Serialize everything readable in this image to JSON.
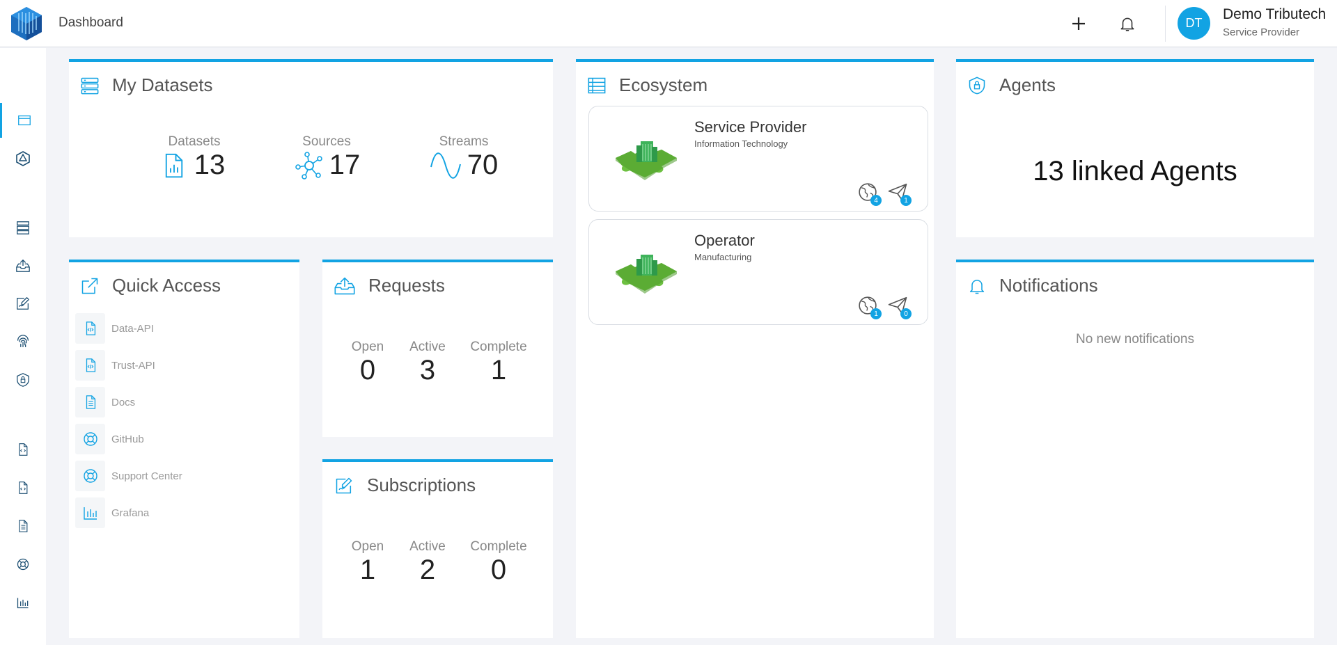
{
  "header": {
    "page_title": "Dashboard",
    "user_initials": "DT",
    "user_name": "Demo Tributech",
    "user_role": "Service Provider"
  },
  "colors": {
    "accent": "#12a3e3",
    "background": "#f3f4f8",
    "puzzle_green": "#6dc041"
  },
  "sidebar": {
    "items": [
      {
        "icon": "window-icon"
      },
      {
        "icon": "ecosystem-icon"
      },
      {
        "icon": "datasets-icon"
      },
      {
        "icon": "requests-icon"
      },
      {
        "icon": "subscriptions-icon"
      },
      {
        "icon": "fingerprint-icon"
      },
      {
        "icon": "agents-icon"
      },
      {
        "icon": "code-file-icon"
      },
      {
        "icon": "code-file-icon"
      },
      {
        "icon": "document-icon"
      },
      {
        "icon": "support-icon"
      },
      {
        "icon": "chart-icon"
      }
    ]
  },
  "datasets": {
    "title": "My Datasets",
    "stats": [
      {
        "label": "Datasets",
        "value": "13",
        "icon": "dataset-file-icon"
      },
      {
        "label": "Sources",
        "value": "17",
        "icon": "network-icon"
      },
      {
        "label": "Streams",
        "value": "70",
        "icon": "wave-icon"
      }
    ]
  },
  "ecosystem": {
    "title": "Ecosystem",
    "nodes": [
      {
        "name": "Service Provider",
        "industry": "Information Technology",
        "connections": "4",
        "sent": "1"
      },
      {
        "name": "Operator",
        "industry": "Manufacturing",
        "connections": "1",
        "sent": "0"
      }
    ]
  },
  "agents": {
    "title": "Agents",
    "summary": "13 linked Agents"
  },
  "quick_access": {
    "title": "Quick Access",
    "items": [
      {
        "label": "Data-API",
        "icon": "code-file-icon"
      },
      {
        "label": "Trust-API",
        "icon": "code-file-icon"
      },
      {
        "label": "Docs",
        "icon": "document-icon"
      },
      {
        "label": "GitHub",
        "icon": "lifebuoy-icon"
      },
      {
        "label": "Support Center",
        "icon": "lifebuoy-icon"
      },
      {
        "label": "Grafana",
        "icon": "chart-icon"
      }
    ]
  },
  "requests": {
    "title": "Requests",
    "stats": [
      {
        "label": "Open",
        "value": "0"
      },
      {
        "label": "Active",
        "value": "3"
      },
      {
        "label": "Complete",
        "value": "1"
      }
    ]
  },
  "subscriptions": {
    "title": "Subscriptions",
    "stats": [
      {
        "label": "Open",
        "value": "1"
      },
      {
        "label": "Active",
        "value": "2"
      },
      {
        "label": "Complete",
        "value": "0"
      }
    ]
  },
  "notifications": {
    "title": "Notifications",
    "empty_text": "No new notifications"
  }
}
